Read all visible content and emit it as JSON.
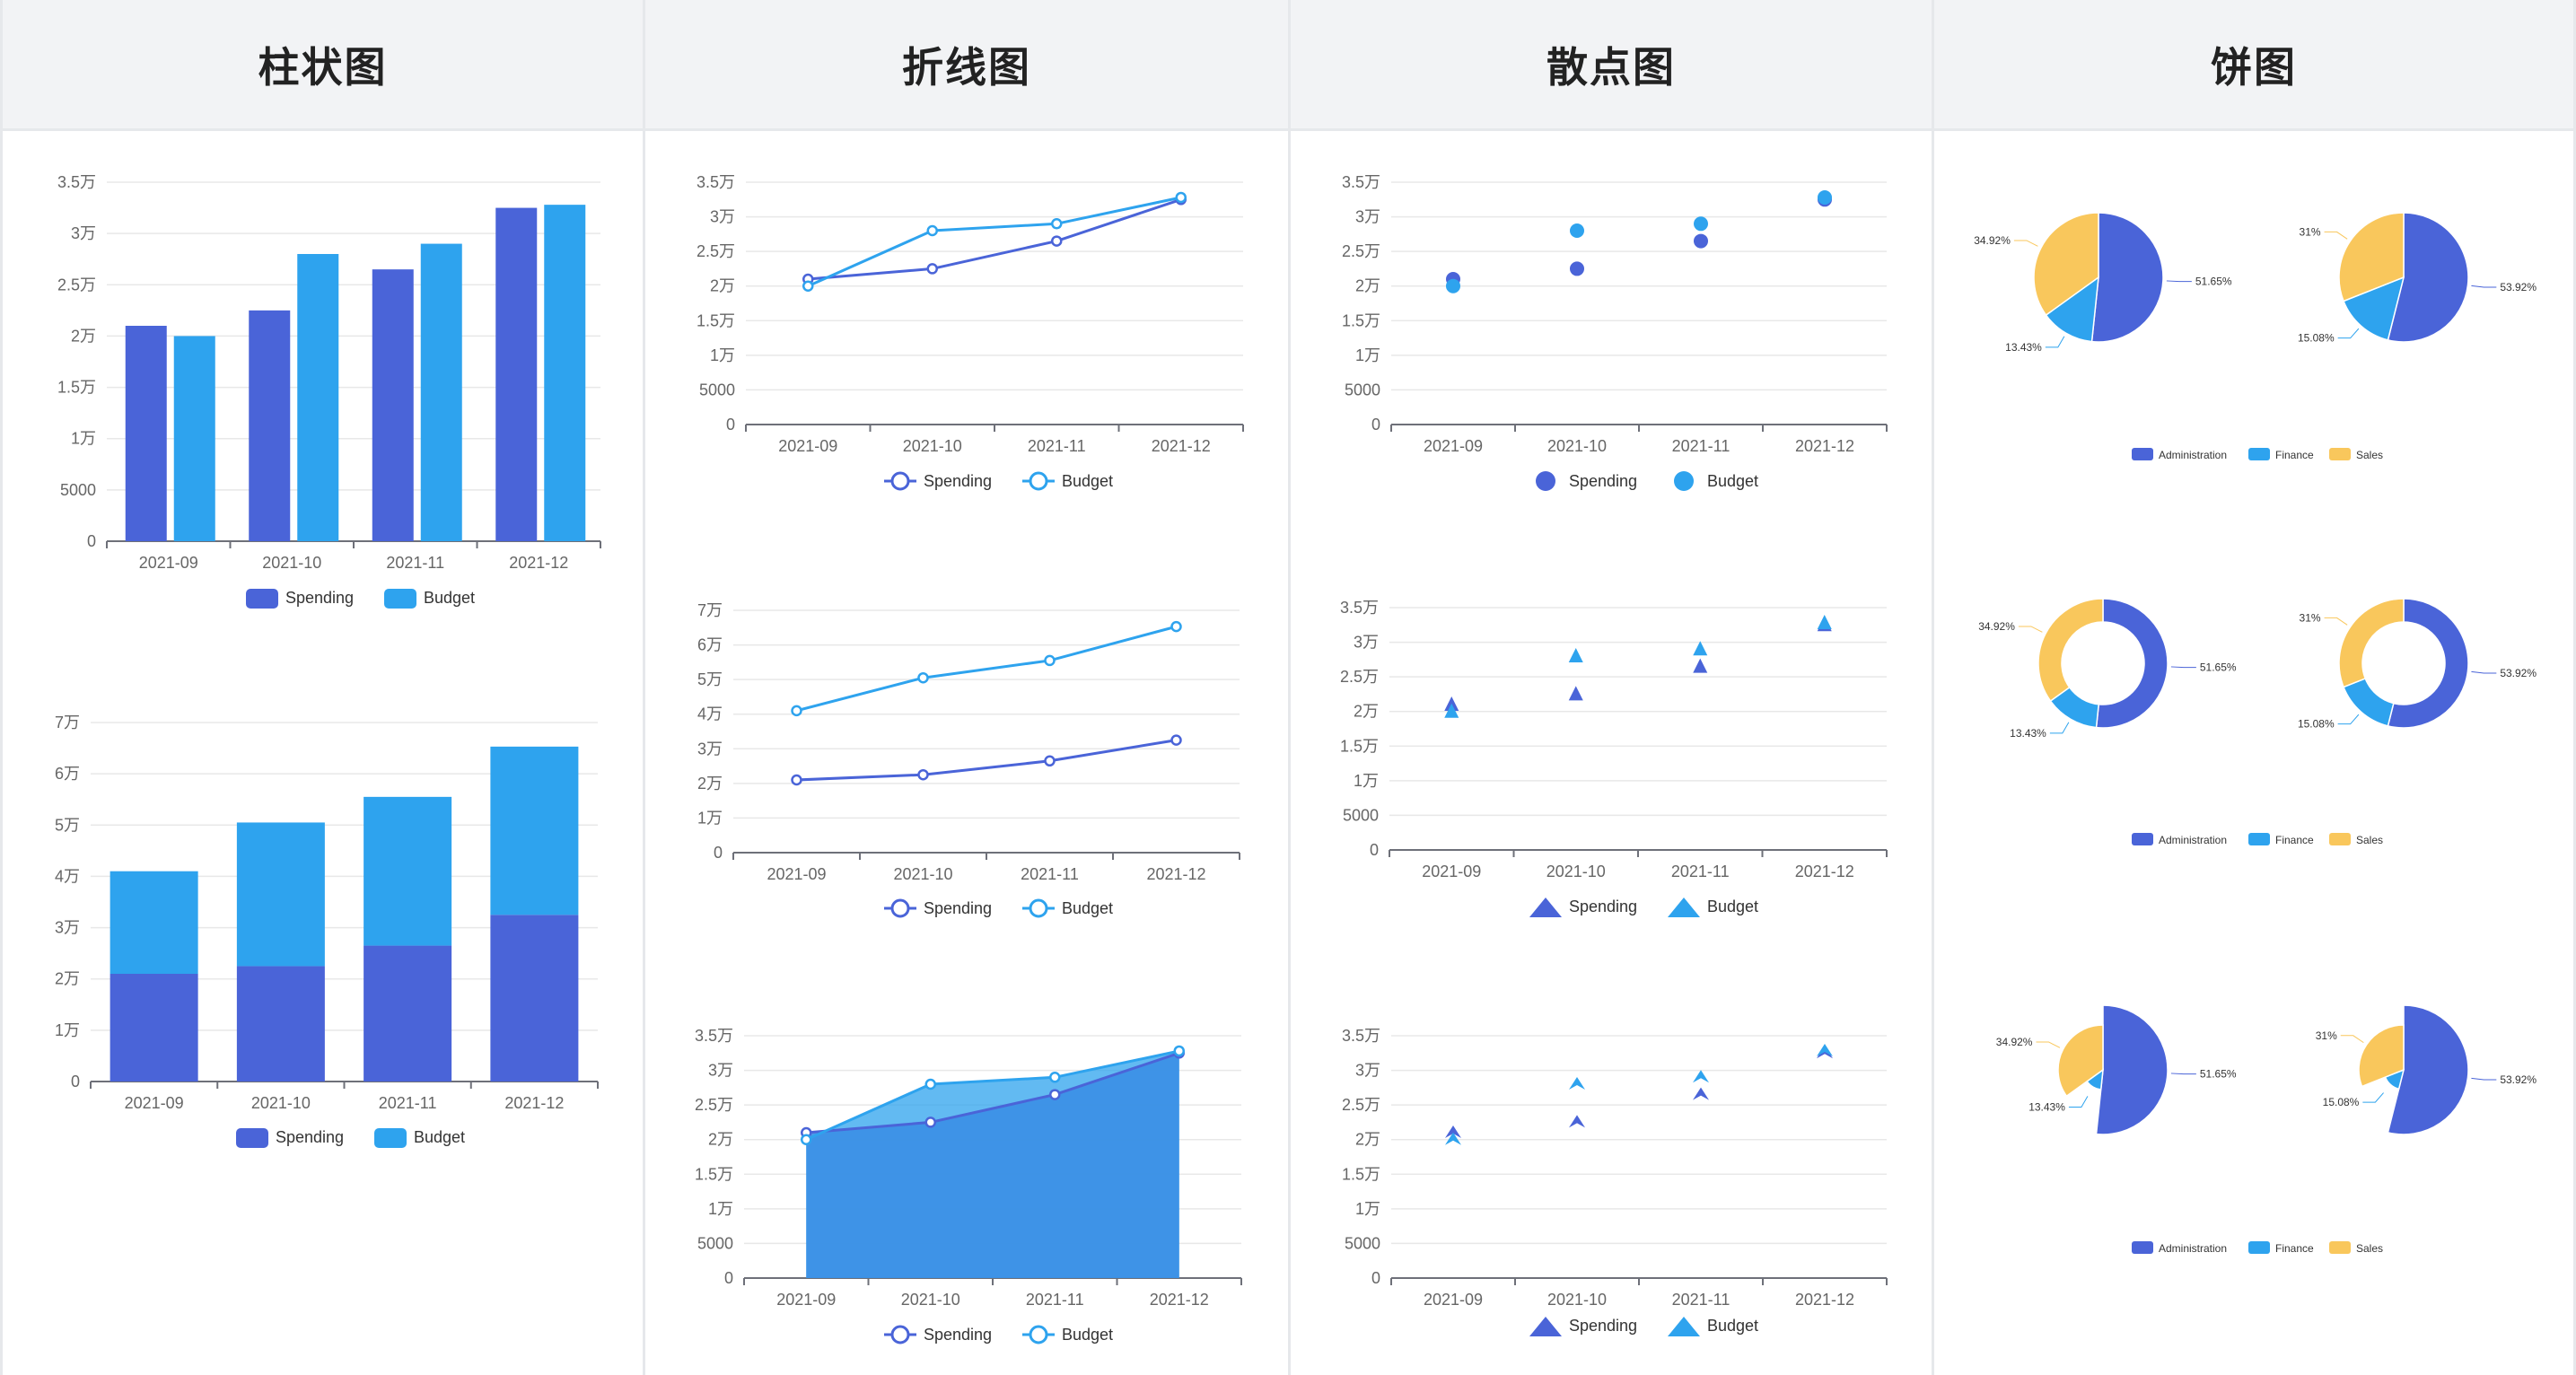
{
  "columns": [
    {
      "key": "bar",
      "title": "柱状图"
    },
    {
      "key": "line",
      "title": "折线图"
    },
    {
      "key": "scatter",
      "title": "散点图"
    },
    {
      "key": "pie",
      "title": "饼图"
    }
  ],
  "colors": {
    "spending": "#4a64d8",
    "budget": "#2ea3ee",
    "administration": "#4a64d8",
    "finance": "#2ea3ee",
    "sales": "#f9c75c",
    "grid": "#e8e8e8",
    "axis": "#6e7079"
  },
  "months": [
    "2021-09",
    "2021-10",
    "2021-11",
    "2021-12"
  ],
  "legend": {
    "spending": "Spending",
    "budget": "Budget"
  },
  "pie_legend": [
    "Administration",
    "Finance",
    "Sales"
  ],
  "chart_data": [
    {
      "id": "bar-grouped",
      "type": "bar",
      "categories": [
        "2021-09",
        "2021-10",
        "2021-11",
        "2021-12"
      ],
      "series": [
        {
          "name": "Spending",
          "values": [
            21000,
            22500,
            26500,
            32500
          ]
        },
        {
          "name": "Budget",
          "values": [
            20000,
            28000,
            29000,
            32800
          ]
        }
      ],
      "ylim": [
        0,
        35000
      ],
      "ticks": [
        "0",
        "5000",
        "1万",
        "1.5万",
        "2万",
        "2.5万",
        "3万",
        "3.5万"
      ]
    },
    {
      "id": "bar-stacked",
      "type": "bar",
      "stacked": true,
      "categories": [
        "2021-09",
        "2021-10",
        "2021-11",
        "2021-12"
      ],
      "series": [
        {
          "name": "Spending",
          "values": [
            21000,
            22500,
            26500,
            32500
          ]
        },
        {
          "name": "Budget",
          "values": [
            20000,
            28000,
            29000,
            32800
          ]
        }
      ],
      "ylim": [
        0,
        70000
      ],
      "ticks": [
        "0",
        "1万",
        "2万",
        "3万",
        "4万",
        "5万",
        "6万",
        "7万"
      ]
    },
    {
      "id": "line-basic",
      "type": "line",
      "categories": [
        "2021-09",
        "2021-10",
        "2021-11",
        "2021-12"
      ],
      "series": [
        {
          "name": "Spending",
          "values": [
            21000,
            22500,
            26500,
            32500
          ]
        },
        {
          "name": "Budget",
          "values": [
            20000,
            28000,
            29000,
            32800
          ]
        }
      ],
      "ylim": [
        0,
        35000
      ],
      "ticks": [
        "0",
        "5000",
        "1万",
        "1.5万",
        "2万",
        "2.5万",
        "3万",
        "3.5万"
      ]
    },
    {
      "id": "line-stacked",
      "type": "line",
      "stacked": true,
      "categories": [
        "2021-09",
        "2021-10",
        "2021-11",
        "2021-12"
      ],
      "series": [
        {
          "name": "Spending",
          "values": [
            21000,
            22500,
            26500,
            32500
          ]
        },
        {
          "name": "Budget",
          "values": [
            20000,
            28000,
            29000,
            32800
          ]
        }
      ],
      "ylim": [
        0,
        70000
      ],
      "ticks": [
        "0",
        "1万",
        "2万",
        "3万",
        "4万",
        "5万",
        "6万",
        "7万"
      ]
    },
    {
      "id": "line-area",
      "type": "area",
      "categories": [
        "2021-09",
        "2021-10",
        "2021-11",
        "2021-12"
      ],
      "series": [
        {
          "name": "Spending",
          "values": [
            21000,
            22500,
            26500,
            32500
          ]
        },
        {
          "name": "Budget",
          "values": [
            20000,
            28000,
            29000,
            32800
          ]
        }
      ],
      "ylim": [
        0,
        35000
      ],
      "ticks": [
        "0",
        "5000",
        "1万",
        "1.5万",
        "2万",
        "2.5万",
        "3万",
        "3.5万"
      ]
    },
    {
      "id": "scatter-circle",
      "type": "scatter",
      "marker": "circle",
      "categories": [
        "2021-09",
        "2021-10",
        "2021-11",
        "2021-12"
      ],
      "series": [
        {
          "name": "Spending",
          "values": [
            21000,
            22500,
            26500,
            32500
          ]
        },
        {
          "name": "Budget",
          "values": [
            20000,
            28000,
            29000,
            32800
          ]
        }
      ],
      "ylim": [
        0,
        35000
      ],
      "ticks": [
        "0",
        "5000",
        "1万",
        "1.5万",
        "2万",
        "2.5万",
        "3万",
        "3.5万"
      ]
    },
    {
      "id": "scatter-triangle",
      "type": "scatter",
      "marker": "triangle",
      "categories": [
        "2021-09",
        "2021-10",
        "2021-11",
        "2021-12"
      ],
      "series": [
        {
          "name": "Spending",
          "values": [
            21000,
            22500,
            26500,
            32500
          ]
        },
        {
          "name": "Budget",
          "values": [
            20000,
            28000,
            29000,
            32800
          ]
        }
      ],
      "ylim": [
        0,
        35000
      ],
      "ticks": [
        "0",
        "5000",
        "1万",
        "1.5万",
        "2万",
        "2.5万",
        "3万",
        "3.5万"
      ]
    },
    {
      "id": "scatter-arrow",
      "type": "scatter",
      "marker": "arrow",
      "categories": [
        "2021-09",
        "2021-10",
        "2021-11",
        "2021-12"
      ],
      "series": [
        {
          "name": "Spending",
          "values": [
            21000,
            22500,
            26500,
            32500
          ]
        },
        {
          "name": "Budget",
          "values": [
            20000,
            28000,
            29000,
            32800
          ]
        }
      ],
      "ylim": [
        0,
        35000
      ],
      "ticks": [
        "0",
        "5000",
        "1万",
        "1.5万",
        "2万",
        "2.5万",
        "3万",
        "3.5万"
      ]
    },
    {
      "id": "pie-a",
      "type": "pie",
      "labels": [
        "Administration",
        "Finance",
        "Sales"
      ],
      "values": [
        51.65,
        13.43,
        34.92
      ],
      "display": [
        "51.65%",
        "13.43%",
        "34.92%"
      ]
    },
    {
      "id": "pie-b",
      "type": "pie",
      "labels": [
        "Administration",
        "Finance",
        "Sales"
      ],
      "values": [
        53.92,
        15.08,
        31
      ],
      "display": [
        "53.92%",
        "15.08%",
        "31%"
      ]
    }
  ]
}
